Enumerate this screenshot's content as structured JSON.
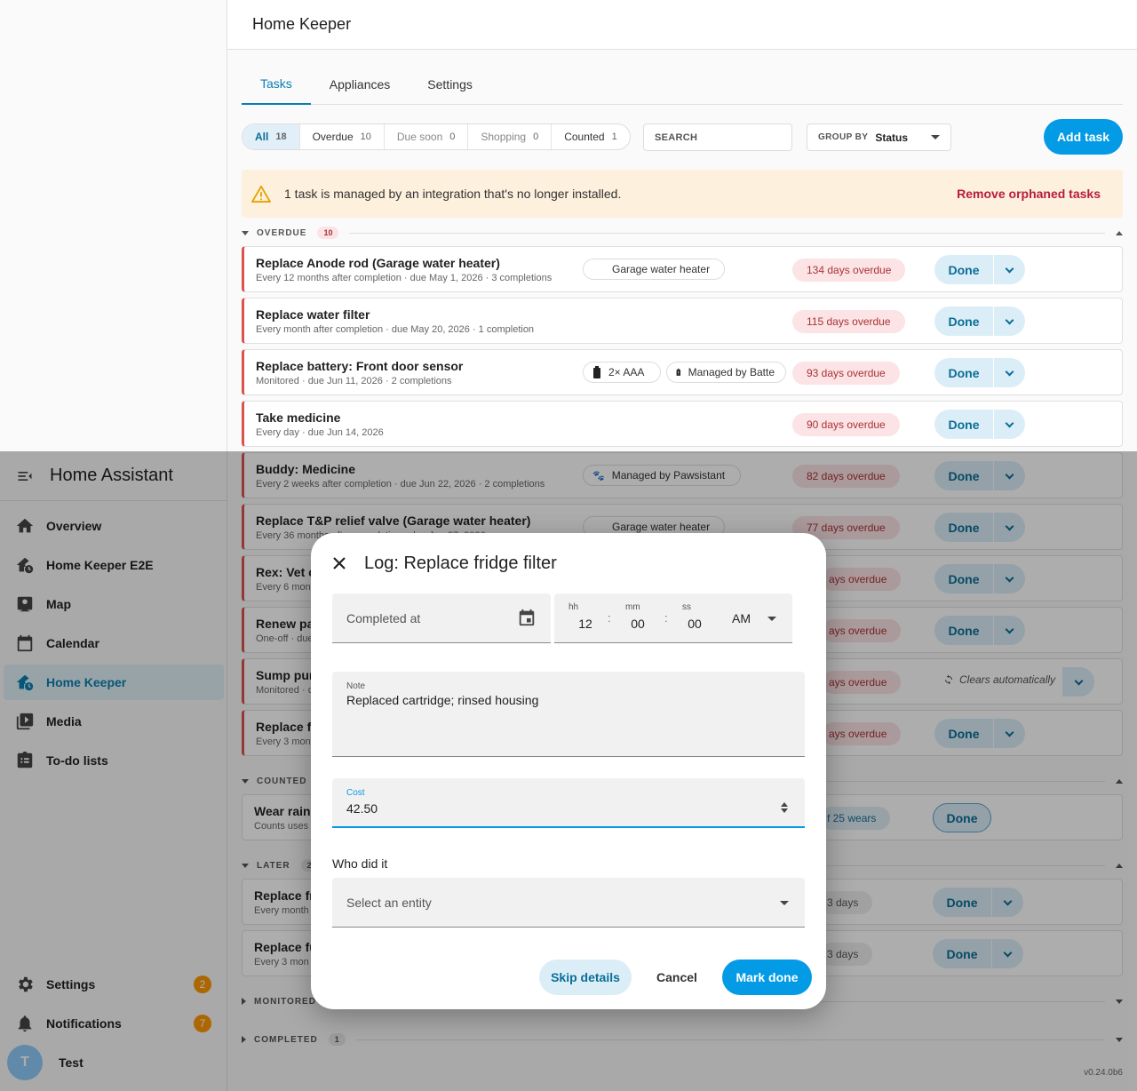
{
  "sidebar": {
    "title": "Home Assistant",
    "items": [
      {
        "label": "Overview"
      },
      {
        "label": "Home Keeper E2E"
      },
      {
        "label": "Map"
      },
      {
        "label": "Calendar"
      },
      {
        "label": "Home Keeper"
      },
      {
        "label": "Media"
      },
      {
        "label": "To-do lists"
      }
    ],
    "settings": {
      "label": "Settings",
      "badge": "2"
    },
    "notifications": {
      "label": "Notifications",
      "badge": "7"
    },
    "user": {
      "initial": "T",
      "name": "Test"
    }
  },
  "page": {
    "title": "Home Keeper",
    "tabs": [
      "Tasks",
      "Appliances",
      "Settings"
    ],
    "filters": [
      {
        "label": "All",
        "count": "18"
      },
      {
        "label": "Overdue",
        "count": "10"
      },
      {
        "label": "Due soon",
        "count": "0"
      },
      {
        "label": "Shopping",
        "count": "0"
      },
      {
        "label": "Counted",
        "count": "1"
      }
    ],
    "search_label": "SEARCH",
    "group_by_label": "GROUP BY",
    "group_by_value": "Status",
    "add_task": "Add task",
    "alert_text": "1 task is managed by an integration that's no longer installed.",
    "alert_action": "Remove orphaned tasks",
    "done_label": "Done",
    "version": "v0.24.0b6"
  },
  "sections": {
    "overdue": {
      "label": "OVERDUE",
      "count": "10"
    },
    "counted": {
      "label": "COUNTED"
    },
    "later": {
      "label": "LATER",
      "count": "2"
    },
    "monitored": {
      "label": "MONITORED"
    },
    "completed": {
      "label": "COMPLETED",
      "count": "1"
    }
  },
  "tasks": [
    {
      "title": "Replace Anode rod (Garage water heater)",
      "sub": "Every 12 months after completion · due May 1, 2026 · 3 completions",
      "chip": "Garage water heater",
      "status": "134 days overdue"
    },
    {
      "title": "Replace water filter",
      "sub": "Every month after completion · due May 20, 2026 · 1 completion",
      "status": "115 days overdue"
    },
    {
      "title": "Replace battery: Front door sensor",
      "sub": "Monitored · due Jun 11, 2026 · 2 completions",
      "chip": "2× AAA",
      "chip2": "Managed by Batte",
      "status": "93 days overdue"
    },
    {
      "title": "Take medicine",
      "sub": "Every day · due Jun 14, 2026",
      "status": "90 days overdue"
    },
    {
      "title": "Buddy: Medicine",
      "sub": "Every 2 weeks after completion · due Jun 22, 2026 · 2 completions",
      "chip": "Managed by Pawsistant",
      "status": "82 days overdue"
    },
    {
      "title": "Replace T&P relief valve (Garage water heater)",
      "sub": "Every 36 months after completion · due Jun 27, 2026",
      "chip": "Garage water heater",
      "status": "77 days overdue"
    },
    {
      "title": "Rex: Vet c",
      "sub": "Every 6 mon",
      "status": "ays overdue"
    },
    {
      "title": "Renew pa",
      "sub": "One-off · due",
      "status": "ays overdue"
    },
    {
      "title": "Sump pum",
      "sub": "Monitored · c",
      "status": "ays overdue",
      "auto": "Clears automatically"
    },
    {
      "title": "Replace fu",
      "sub": "Every 3 mon",
      "status": "ays overdue"
    },
    {
      "title": "Wear rain",
      "sub": "Counts uses",
      "status": "f 25 wears"
    },
    {
      "title": "Replace fr",
      "sub": "Every month",
      "status": "3 days"
    },
    {
      "title": "Replace fu",
      "sub": "Every 3 mon",
      "status": "3 days"
    }
  ],
  "dialog": {
    "title": "Log: Replace fridge filter",
    "completed_at": "Completed at",
    "time": {
      "hh_label": "hh",
      "hh": "12",
      "mm_label": "mm",
      "mm": "00",
      "ss_label": "ss",
      "ss": "00",
      "ampm": "AM"
    },
    "note_label": "Note",
    "note_value": "Replaced cartridge; rinsed housing",
    "cost_label": "Cost",
    "cost_value": "42.50",
    "who_label": "Who did it",
    "who_placeholder": "Select an entity",
    "skip": "Skip details",
    "cancel": "Cancel",
    "mark_done": "Mark done"
  }
}
